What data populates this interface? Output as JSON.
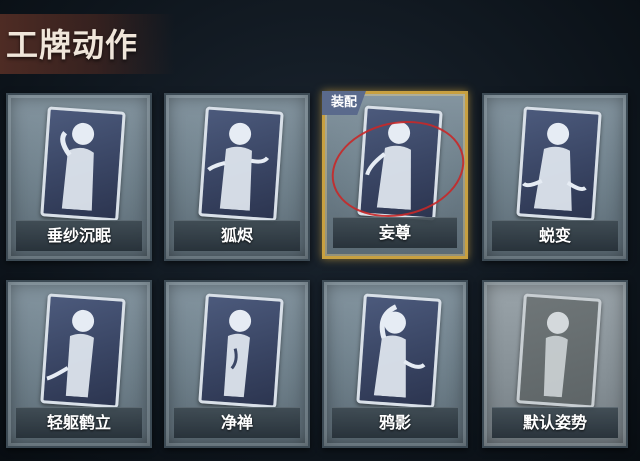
{
  "header": {
    "title": "工牌动作"
  },
  "cards": [
    {
      "label": "垂纱沉眠",
      "state": "normal"
    },
    {
      "label": "狐烬",
      "state": "normal"
    },
    {
      "label": "妄尊",
      "state": "equipped",
      "badge": "装配"
    },
    {
      "label": "蜕变",
      "state": "normal"
    },
    {
      "label": "轻躯鹤立",
      "state": "normal"
    },
    {
      "label": "净禅",
      "state": "normal"
    },
    {
      "label": "鸦影",
      "state": "normal"
    },
    {
      "label": "默认姿势",
      "state": "default"
    }
  ],
  "colors": {
    "equipped_border": "#c8a040",
    "badge_bg": "#5a6a8c",
    "selection_ring": "#c82828"
  }
}
